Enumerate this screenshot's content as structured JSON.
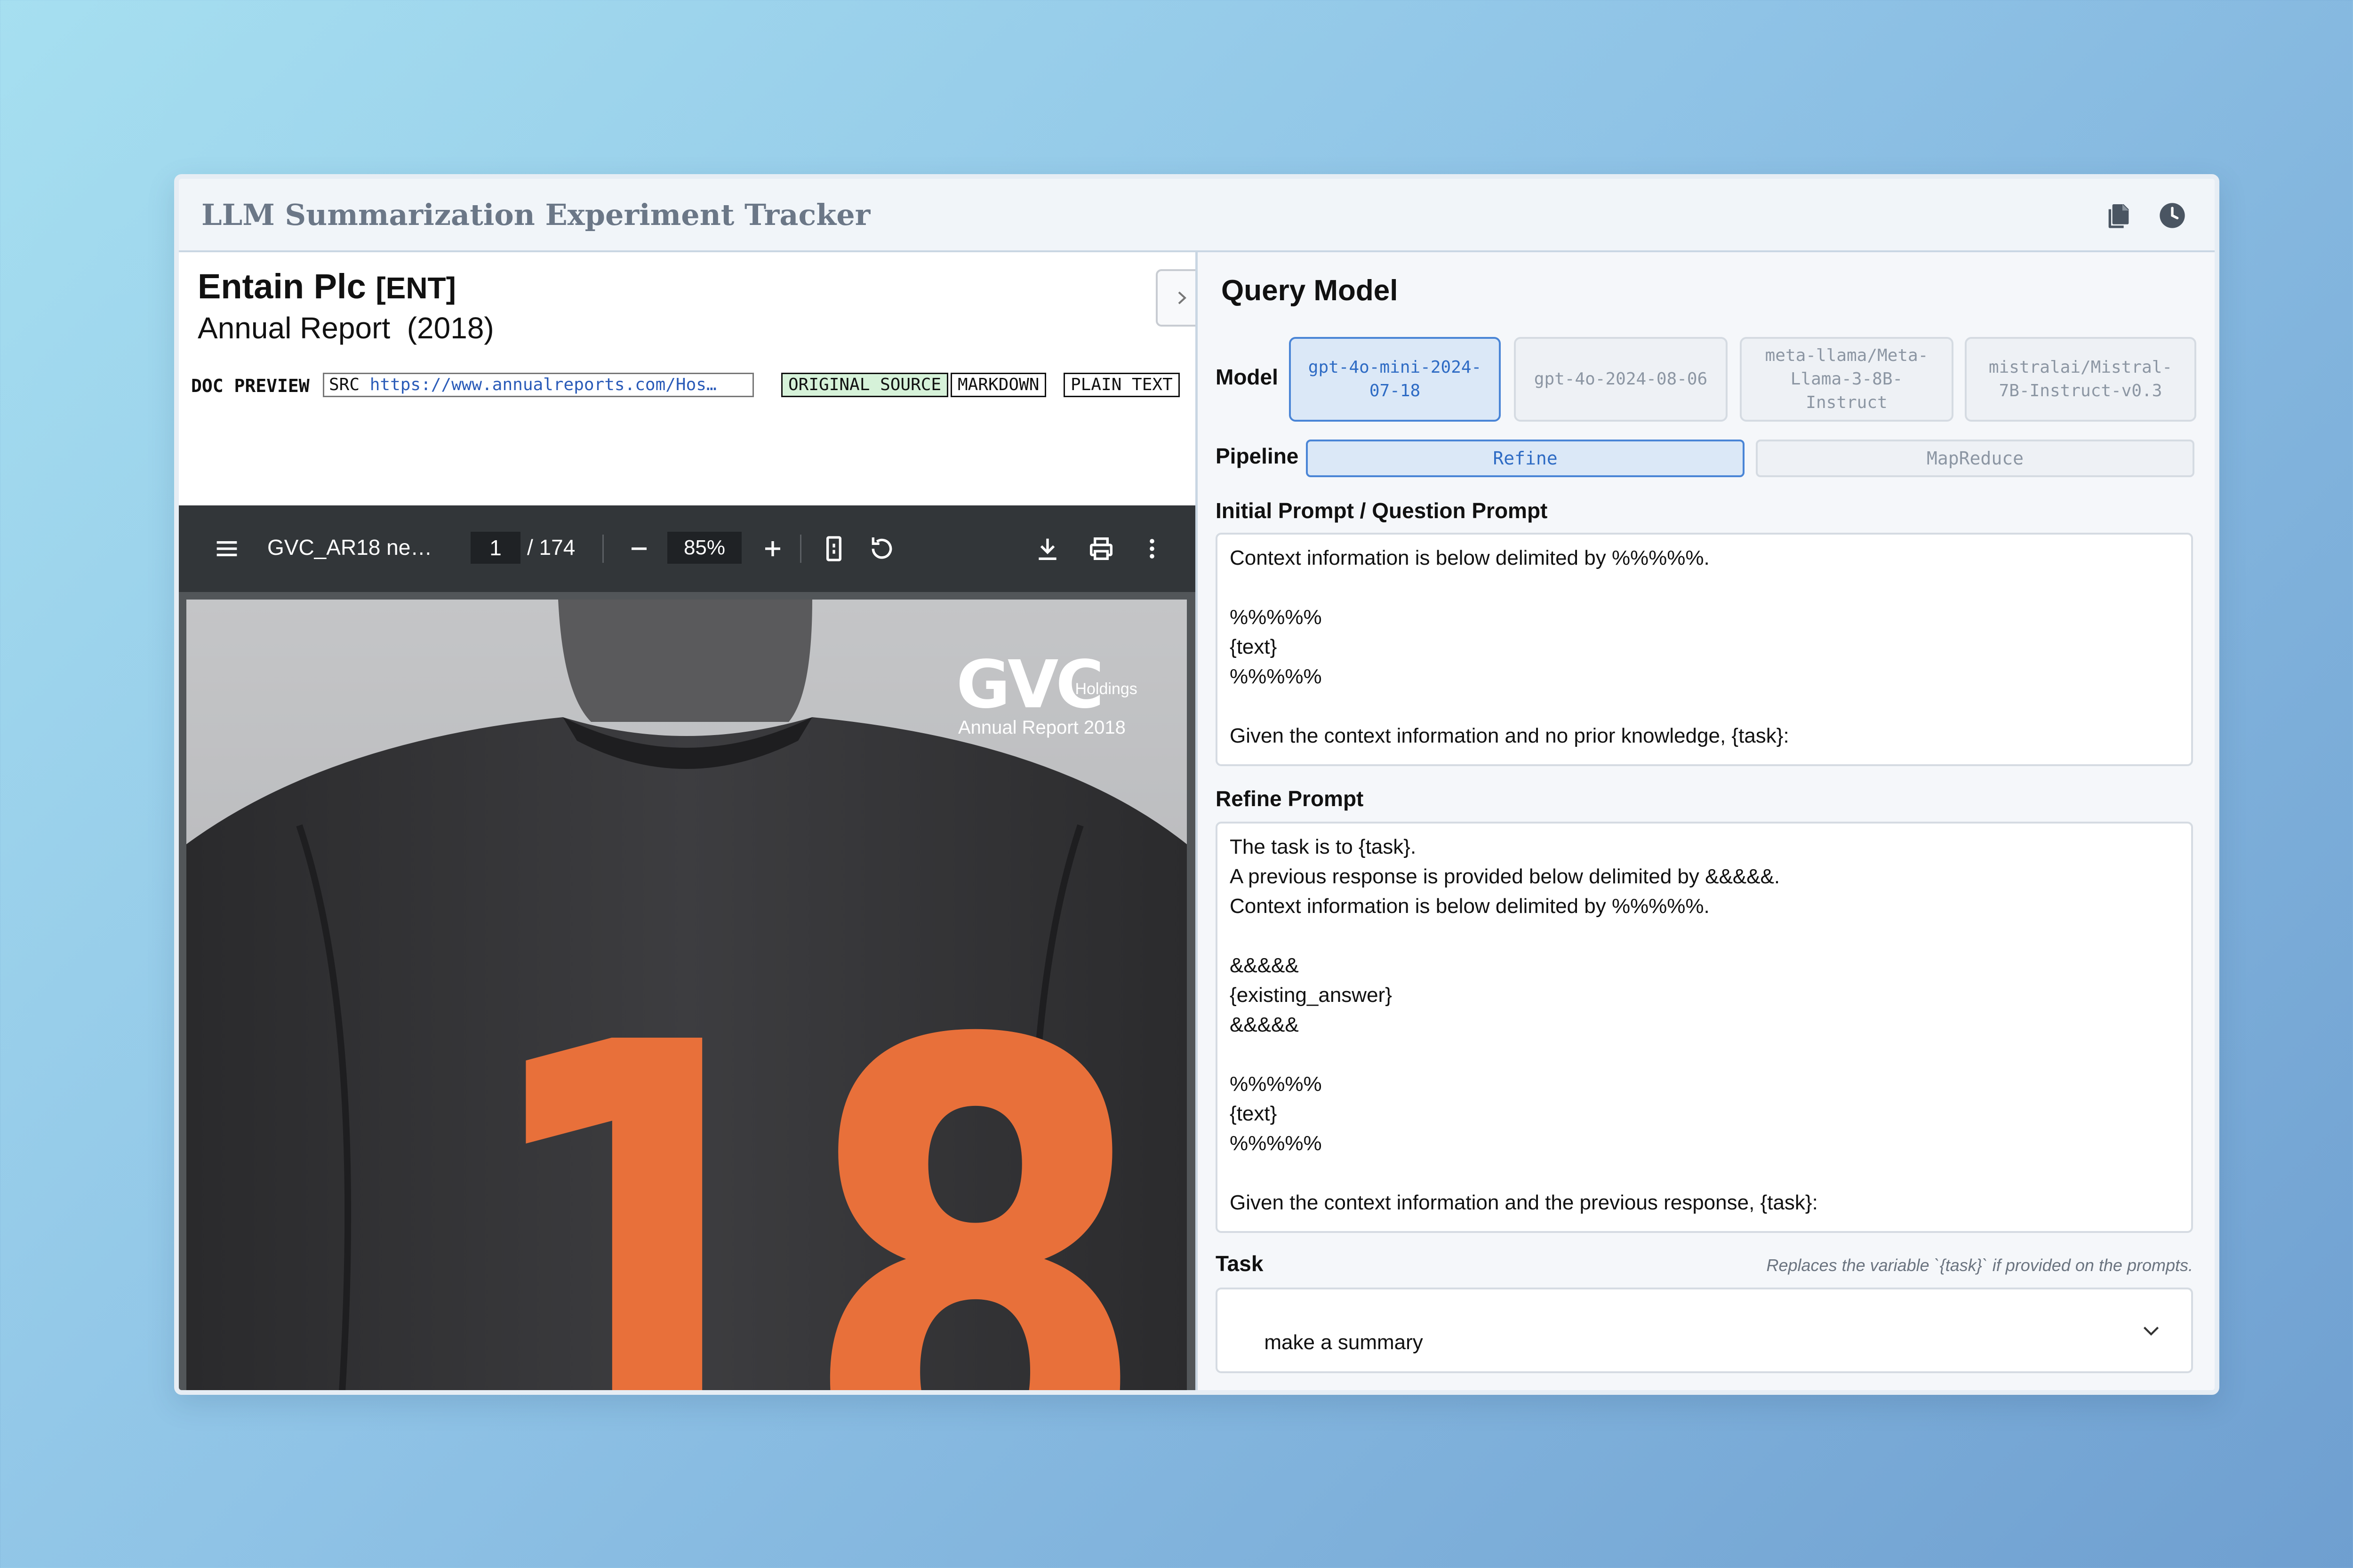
{
  "app": {
    "title": "LLM Summarization Experiment Tracker",
    "icons": [
      "copy-documents-icon",
      "history-clock-icon"
    ]
  },
  "document": {
    "company": "Entain Plc",
    "ticker": "[ENT]",
    "report_type": "Annual Report",
    "year": "(2018)",
    "doc_preview_label": "DOC PREVIEW",
    "src_label": "SRC",
    "src_url": "https://www.annualreports.com/Hos…",
    "tabs": [
      {
        "label": "ORIGINAL SOURCE",
        "active": true
      },
      {
        "label": "MARKDOWN",
        "active": false
      },
      {
        "label": "PLAIN TEXT",
        "active": false
      }
    ]
  },
  "pdf_viewer": {
    "filename": "GVC_AR18 ne…",
    "current_page": "1",
    "total_pages": "/ 174",
    "zoom": "85%",
    "cover": {
      "brand": "GVC",
      "brand_sub": "Holdings",
      "caption": "Annual Report 2018",
      "jersey_number": "18"
    }
  },
  "query": {
    "title": "Query Model",
    "model_label": "Model",
    "models": [
      {
        "label": "gpt-4o-mini-2024-07-18",
        "active": true
      },
      {
        "label": "gpt-4o-2024-08-06",
        "active": false
      },
      {
        "label": "meta-llama/Meta-Llama-3-8B-Instruct",
        "active": false
      },
      {
        "label": "mistralai/Mistral-7B-Instruct-v0.3",
        "active": false
      }
    ],
    "pipeline_label": "Pipeline",
    "pipelines": [
      {
        "label": "Refine",
        "active": true
      },
      {
        "label": "MapReduce",
        "active": false
      }
    ],
    "initial_prompt_label": "Initial Prompt / Question Prompt",
    "initial_prompt": "Context information is below delimited by %%%%%.\n\n%%%%%\n{text}\n%%%%%\n\nGiven the context information and no prior knowledge, {task}:",
    "refine_prompt_label": "Refine Prompt",
    "refine_prompt": "The task is to {task}.\nA previous response is provided below delimited by &&&&&.\nContext information is below delimited by %%%%%.\n\n&&&&&\n{existing_answer}\n&&&&&\n\n%%%%%\n{text}\n%%%%%\n\nGiven the context information and the previous response, {task}:",
    "task_label": "Task",
    "task_hint": "Replaces the variable `{task}` if provided on the prompts.",
    "task_value": "make a summary"
  },
  "colors": {
    "accent": "#4a85d6",
    "jersey_orange": "#e8703a",
    "active_tab_green": "#d6f2d9"
  }
}
